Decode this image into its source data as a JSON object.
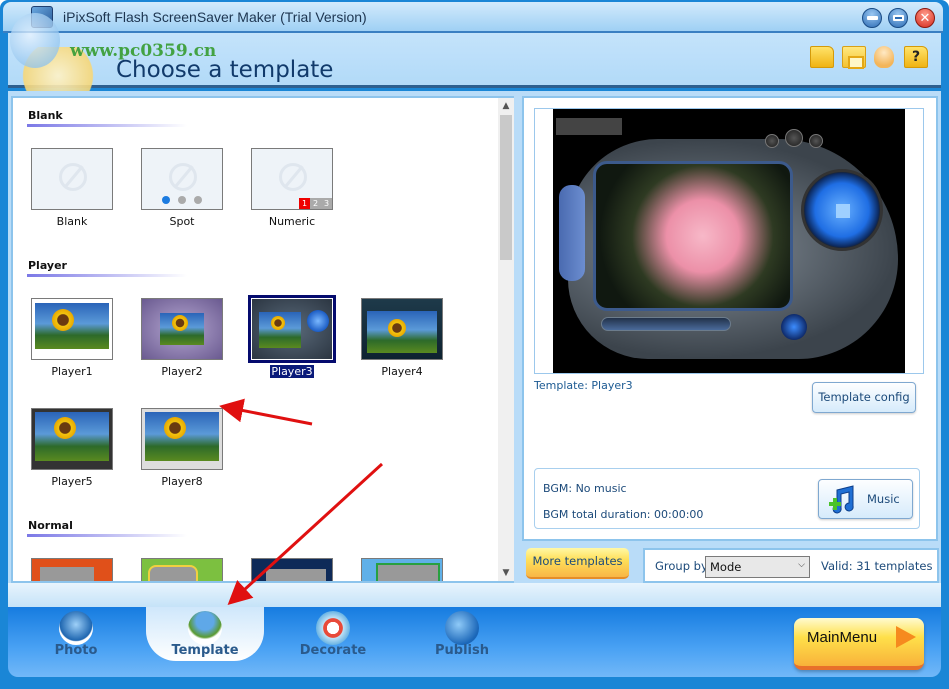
{
  "window": {
    "title": "iPixSoft Flash ScreenSaver Maker (Trial Version)",
    "controls": [
      "minimize",
      "maximize",
      "close"
    ]
  },
  "watermark": {
    "url": "www.pc0359.cn"
  },
  "header": {
    "page_title": "Choose a template",
    "toolbar_icons": [
      "open-folder-icon",
      "save-icon",
      "user-icon",
      "help-icon"
    ]
  },
  "templates": {
    "sections": [
      {
        "title": "Blank",
        "items": [
          {
            "label": "Blank",
            "style": "blank"
          },
          {
            "label": "Spot",
            "style": "spot"
          },
          {
            "label": "Numeric",
            "style": "numeric",
            "numbers": [
              "1",
              "2",
              "3"
            ]
          }
        ]
      },
      {
        "title": "Player",
        "items": [
          {
            "label": "Player1",
            "style": "player1"
          },
          {
            "label": "Player2",
            "style": "player2"
          },
          {
            "label": "Player3",
            "style": "player3",
            "selected": true
          },
          {
            "label": "Player4",
            "style": "player4"
          },
          {
            "label": "Player5",
            "style": "player5"
          },
          {
            "label": "Player8",
            "style": "player8"
          }
        ]
      },
      {
        "title": "Normal",
        "items": [
          {
            "label": "",
            "style": "normal-red"
          },
          {
            "label": "",
            "style": "normal-green"
          },
          {
            "label": "",
            "style": "normal-navy"
          },
          {
            "label": "",
            "style": "normal-sky"
          }
        ]
      }
    ]
  },
  "preview": {
    "template_label": "Template:  Player3",
    "config_button": "Template config"
  },
  "bgm": {
    "music_line": "BGM: No music",
    "duration_line": "BGM total duration: 00:00:00",
    "music_button": "Music"
  },
  "footer_controls": {
    "more_templates": "More templates",
    "group_by_label": "Group by",
    "group_by_value": "Mode",
    "valid_count": "Valid: 31 templates"
  },
  "bottom_tabs": [
    {
      "label": "Photo",
      "active": false
    },
    {
      "label": "Template",
      "active": true
    },
    {
      "label": "Decorate",
      "active": false
    },
    {
      "label": "Publish",
      "active": false
    }
  ],
  "main_menu_button": "MainMenu",
  "colors": {
    "accent_blue": "#1a86d6",
    "selection_navy": "#050b6e",
    "annotation_red": "#e01010"
  }
}
